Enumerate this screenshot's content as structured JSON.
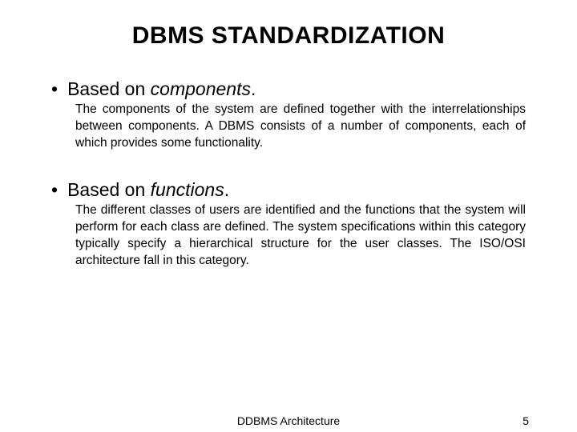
{
  "title": "DBMS STANDARDIZATION",
  "items": [
    {
      "heading_prefix": "Based on ",
      "heading_em": "components",
      "heading_suffix": ".",
      "body": "The components of the system are defined together with the interrelationships between components. A DBMS consists of a number of components, each of which provides some functionality."
    },
    {
      "heading_prefix": "Based on ",
      "heading_em": "functions",
      "heading_suffix": ".",
      "body": "The different classes of users are identified and the functions that the system will perform for each class are defined. The system specifications within this category typically specify a hierarchical structure for the user classes. The ISO/OSI architecture fall in this category."
    }
  ],
  "footer": {
    "center": "DDBMS Architecture",
    "page": "5"
  }
}
